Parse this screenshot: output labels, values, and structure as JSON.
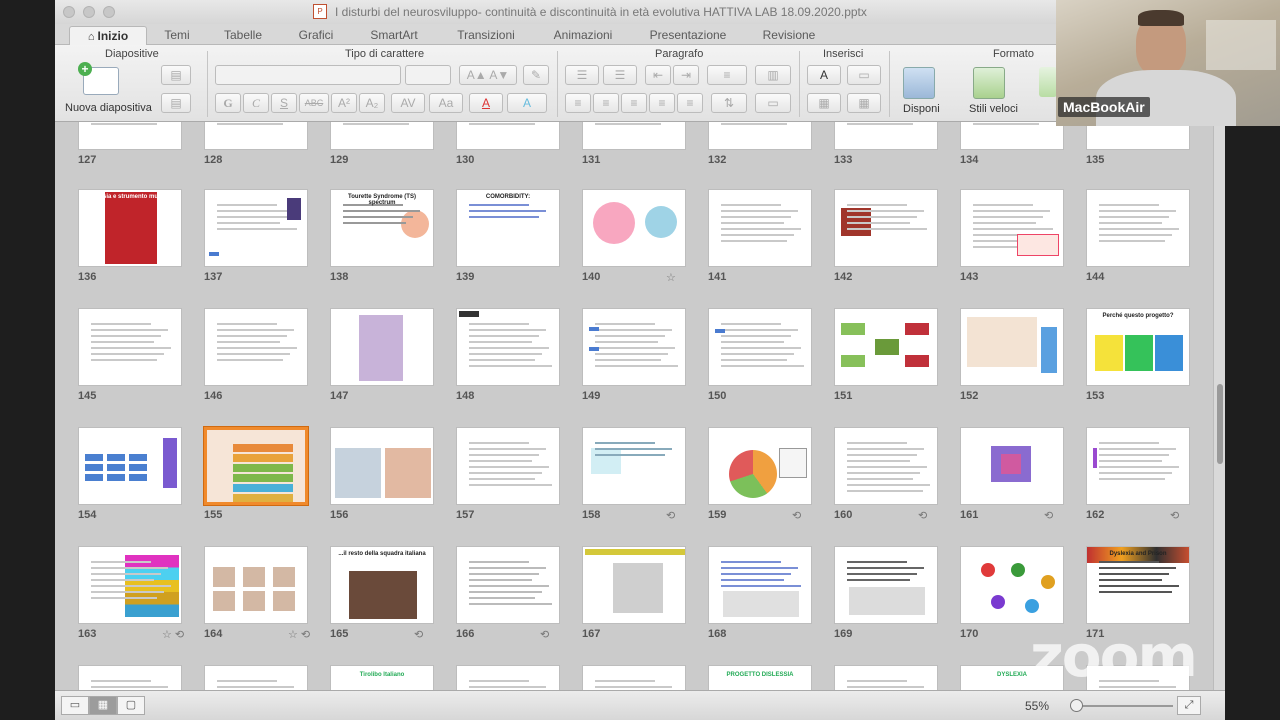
{
  "window": {
    "title": "I disturbi del neurosviluppo- continuità e discontinuità in età evolutiva HATTIVA LAB 18.09.2020.pptx",
    "file_icon": "P"
  },
  "tabs": [
    "Inizio",
    "Temi",
    "Tabelle",
    "Grafici",
    "SmartArt",
    "Transizioni",
    "Animazioni",
    "Presentazione",
    "Revisione"
  ],
  "ribbon": {
    "groups": {
      "diapositive": "Diapositive",
      "carattere": "Tipo di carattere",
      "paragrafo": "Paragrafo",
      "inserisci": "Inserisci",
      "formato": "Formato"
    },
    "new_slide": "Nuova diapositiva",
    "arrange": "Disponi",
    "quick_styles": "Stili veloci",
    "font_buttons": [
      "G",
      "C",
      "S",
      "ABC",
      "A²",
      "A₂",
      "AV",
      "Aa",
      "A",
      "A"
    ]
  },
  "slides": [
    {
      "num": "127"
    },
    {
      "num": "128"
    },
    {
      "num": "129"
    },
    {
      "num": "130"
    },
    {
      "num": "131"
    },
    {
      "num": "132"
    },
    {
      "num": "133"
    },
    {
      "num": "134"
    },
    {
      "num": "135"
    },
    {
      "num": "136",
      "text": "Dislessia e strumento musicale"
    },
    {
      "num": "137"
    },
    {
      "num": "138",
      "text": "Tourette Syndrome (TS) spectrum"
    },
    {
      "num": "139",
      "text": "COMORBIDITY:"
    },
    {
      "num": "140",
      "badge": "☆"
    },
    {
      "num": "141"
    },
    {
      "num": "142"
    },
    {
      "num": "143"
    },
    {
      "num": "144"
    },
    {
      "num": "145"
    },
    {
      "num": "146"
    },
    {
      "num": "147"
    },
    {
      "num": "148"
    },
    {
      "num": "149"
    },
    {
      "num": "150"
    },
    {
      "num": "151"
    },
    {
      "num": "152"
    },
    {
      "num": "153",
      "text": "Perché questo progetto?"
    },
    {
      "num": "154"
    },
    {
      "num": "155",
      "selected": true
    },
    {
      "num": "156"
    },
    {
      "num": "157"
    },
    {
      "num": "158",
      "badge": "⟲"
    },
    {
      "num": "159",
      "badge": "⟲"
    },
    {
      "num": "160",
      "badge": "⟲"
    },
    {
      "num": "161",
      "badge": "⟲"
    },
    {
      "num": "162",
      "badge": "⟲"
    },
    {
      "num": "163",
      "badge": "☆ ⟲"
    },
    {
      "num": "164",
      "badge": "☆ ⟲"
    },
    {
      "num": "165",
      "badge": "⟲",
      "text": "...il resto della squadra italiana"
    },
    {
      "num": "166",
      "badge": "⟲"
    },
    {
      "num": "167"
    },
    {
      "num": "168"
    },
    {
      "num": "169"
    },
    {
      "num": "170"
    },
    {
      "num": "171",
      "text": "Dyslexia and Prison"
    }
  ],
  "bottom_row_partial": [
    "",
    "",
    "Tirolibo Italiano",
    "",
    "",
    "PROGETTO DISLESSIA",
    "",
    "DYSLEXIA",
    ""
  ],
  "status": {
    "zoom": "55%",
    "views": [
      "normal",
      "sorter",
      "presenter"
    ]
  },
  "camera": {
    "label": "MacBookAir"
  },
  "watermark": "zoom",
  "colors": {
    "selection": "#f08a2c",
    "ribbon_bg": "#ececec",
    "sorter_bg": "#cbcbcb"
  }
}
